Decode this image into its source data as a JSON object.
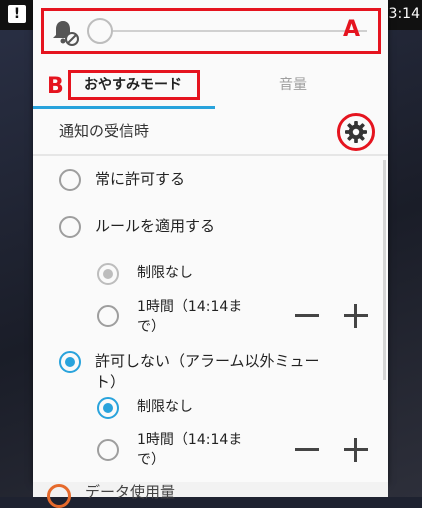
{
  "statusbar": {
    "clock": "3:14",
    "alert_glyph": "!"
  },
  "volume": {
    "icon": "bell-muted-icon",
    "level": 0
  },
  "annotations": {
    "a_label": "A",
    "b_label": "B"
  },
  "tabs": [
    {
      "label": "おやすみモード",
      "active": true
    },
    {
      "label": "音量",
      "active": false
    }
  ],
  "section": {
    "label": "通知の受信時",
    "icon": "gear-icon"
  },
  "options": {
    "always": {
      "label": "常に許可する",
      "checked": false
    },
    "rules": {
      "label": "ルールを適用する",
      "checked": false,
      "sub_unlimited": "制限なし",
      "sub_hour_line1": "1時間（14:14ま",
      "sub_hour_line2": "で）"
    },
    "block": {
      "label_line1": "許可しない（アラーム以外ミュー",
      "label_line2": "ト）",
      "checked": true,
      "sub_unlimited": "制限なし",
      "sub_hour_line1": "1時間（14:14ま",
      "sub_hour_line2": "で）"
    }
  },
  "bottom_peek": {
    "label": "データ使用量"
  },
  "colors": {
    "accent": "#29a3dc",
    "annotation": "#e5141f"
  }
}
